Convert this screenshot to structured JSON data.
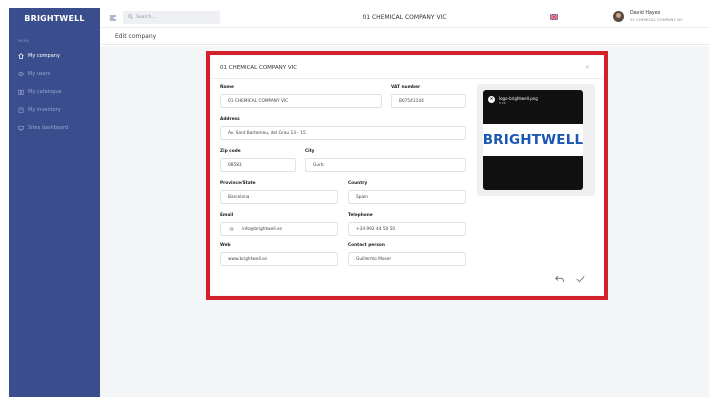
{
  "sidebar": {
    "brand": "BRIGHTWELL",
    "menu_label": "MENU",
    "items": [
      {
        "label": "My company",
        "icon": "home-icon",
        "active": true
      },
      {
        "label": "My users",
        "icon": "eye-icon",
        "active": false
      },
      {
        "label": "My catalogue",
        "icon": "book-icon",
        "active": false
      },
      {
        "label": "My inventory",
        "icon": "clipboard-icon",
        "active": false
      },
      {
        "label": "Sites dashboard",
        "icon": "monitor-icon",
        "active": false
      }
    ]
  },
  "topbar": {
    "search_placeholder": "Search...",
    "company": "01 CHEMICAL COMPANY VIC",
    "user_name": "David Hayes",
    "user_company": "01 CHEMICAL COMPANY VIC"
  },
  "page": {
    "title": "Edit company"
  },
  "modal": {
    "title": "01 CHEMICAL COMPANY VIC",
    "close": "×",
    "fields": {
      "name": {
        "label": "Name",
        "value": "01 CHEMICAL COMPANY VIC"
      },
      "vat": {
        "label": "VAT number",
        "value": "B67541144"
      },
      "address": {
        "label": "Address",
        "value": "Av. Sant Bartomeu, del Grau 13 - 15"
      },
      "zip": {
        "label": "Zip code",
        "value": "08583"
      },
      "city": {
        "label": "City",
        "value": "Gurb"
      },
      "province": {
        "label": "Province/State",
        "value": "Barcelona"
      },
      "country": {
        "label": "Country",
        "value": "Spain"
      },
      "email": {
        "label": "Email",
        "prefix": "@",
        "value": "info@brightwell.es"
      },
      "telephone": {
        "label": "Telephone",
        "value": "+34 992 44 50 50"
      },
      "web": {
        "label": "Web",
        "value": "www.brightwell.es"
      },
      "contact": {
        "label": "Contact person",
        "value": "Guillermo Moser"
      }
    },
    "logo": {
      "filename": "logo-brightwell.png",
      "size": "8 kB",
      "remove": "×",
      "image_text": "BRIGHTWELL"
    }
  },
  "colors": {
    "sidebar": "#3a4d8c",
    "highlight": "#d4202a",
    "logo_blue": "#1a57b3"
  }
}
